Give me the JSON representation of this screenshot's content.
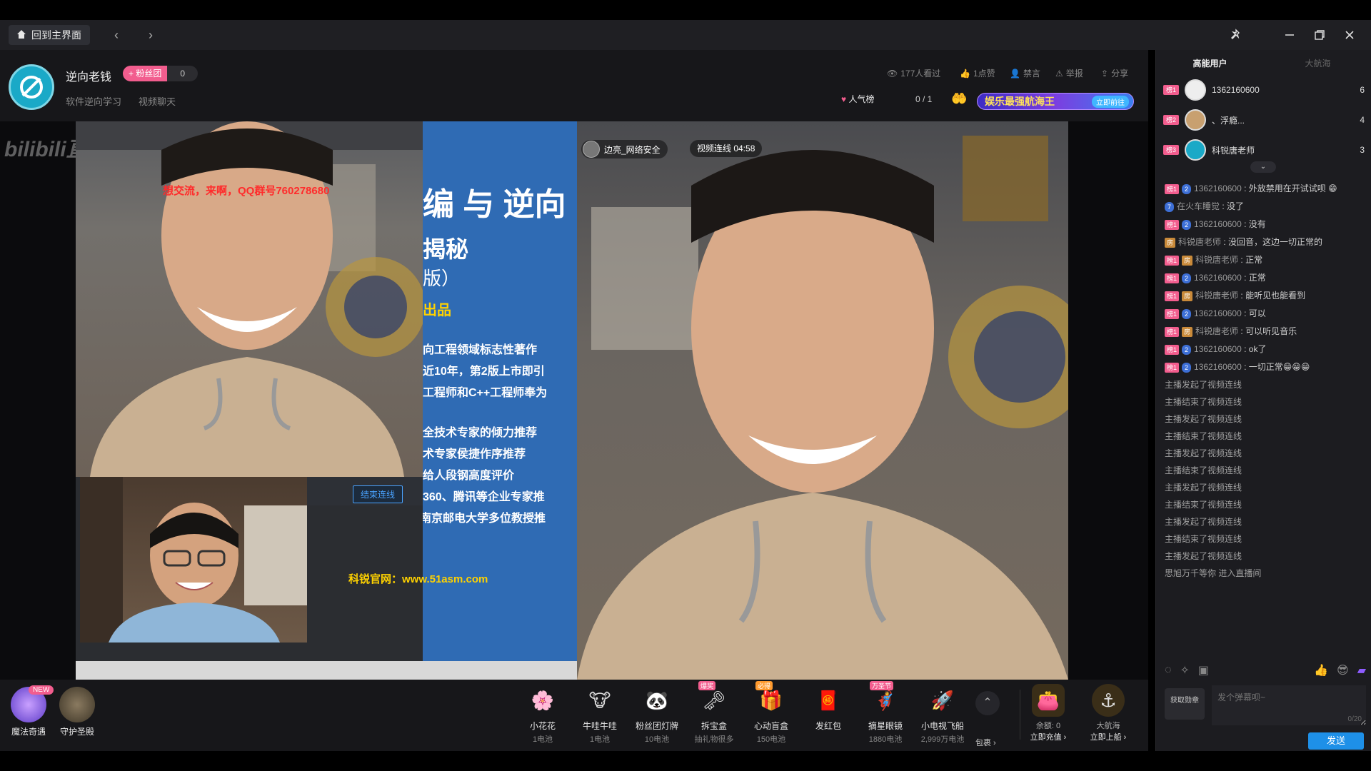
{
  "topbar": {
    "home_label": "回到主界面"
  },
  "header": {
    "host_name": "逆向老钱",
    "fans_label": "+ 粉丝团",
    "fans_count": "0",
    "tags": [
      "软件逆向学习",
      "视频聊天"
    ],
    "stats": {
      "viewers": "177人看过",
      "likes": "1点赞",
      "mute": "禁言",
      "report": "举报",
      "share": "分享"
    },
    "rank_label": "人气榜",
    "rank_value": "0 / 1",
    "banner_text": "娱乐最强航海王",
    "banner_tag": "立即前往"
  },
  "video": {
    "watermark": "bilibili直播",
    "overlay_red": "想交流，来啊，QQ群号760278680",
    "slide": {
      "title": "编 与 逆向",
      "sub": "揭秘",
      "sub2": "版）",
      "produced": "出品",
      "lines": [
        "向工程领域标志性著作",
        "近10年，第2版上市即引",
        "工程师和C++工程师奉为",
        "全技术专家的倾力推荐",
        "术专家侯捷作序推荐",
        "给人段钢高度评价",
        "360、腾讯等企业专家推",
        "武汉大学、南京邮电大学多位教授推"
      ],
      "website": "科锐官网：www.51asm.com"
    },
    "end_link_label": "结束连线",
    "link_user": "边亮_网络安全",
    "link_status": "视频连线  04:58"
  },
  "giftbar": {
    "features": [
      {
        "name": "魔法奇遇",
        "badge": "NEW"
      },
      {
        "name": "守护圣殿",
        "badge": ""
      }
    ],
    "gifts": [
      {
        "name": "小花花",
        "price": "1电池",
        "emoji": "🌸",
        "corner": ""
      },
      {
        "name": "牛哇牛哇",
        "price": "1电池",
        "emoji": "🐮",
        "corner": ""
      },
      {
        "name": "粉丝团灯牌",
        "price": "10电池",
        "emoji": "🐼",
        "corner": ""
      },
      {
        "name": "拆宝盒",
        "price": "抽礼物很多",
        "emoji": "🗝",
        "corner": "爆奖"
      },
      {
        "name": "心动盲盒",
        "price": "150电池",
        "emoji": "🎁",
        "corner": "必得"
      },
      {
        "name": "发红包",
        "price": "",
        "emoji": "🧧",
        "corner": ""
      },
      {
        "name": "摘星眼镜",
        "price": "1880电池",
        "emoji": "🦸",
        "corner": "万圣节"
      },
      {
        "name": "小电视飞船",
        "price": "2,999万电池",
        "emoji": "🚀",
        "corner": ""
      }
    ],
    "more_label": "包裹 ›",
    "balance_label": "余额: 0",
    "recharge_label": "立即充值 ›",
    "captain_label": "大航海",
    "board_label": "立即上船 ›"
  },
  "sidepanel": {
    "tabs": [
      "高能用户",
      "大航海"
    ],
    "ranking": [
      {
        "rank": "榜1",
        "name": "1362160600",
        "score": "6"
      },
      {
        "rank": "榜2",
        "name": "、浮瘾...",
        "score": "4"
      },
      {
        "rank": "榜3",
        "name": "科锐唐老师",
        "score": "3"
      }
    ],
    "chat": [
      {
        "lv": "榜1",
        "vv": "2",
        "user": "1362160600",
        "text": "外放禁用在开试试呗 😁",
        "sys": false
      },
      {
        "lv": "",
        "vv": "7",
        "user": "在火车睡觉",
        "text": "没了",
        "sys": false
      },
      {
        "lv": "榜1",
        "vv": "2",
        "user": "1362160600",
        "text": "没有",
        "sys": false
      },
      {
        "lv": "",
        "room": "房",
        "user": "科锐唐老师",
        "text": "没回音，这边一切正常的",
        "sys": false
      },
      {
        "lv": "榜1",
        "room": "房",
        "user": "科锐唐老师",
        "text": "正常",
        "sys": false
      },
      {
        "lv": "榜1",
        "vv": "2",
        "user": "1362160600",
        "text": "正常",
        "sys": false
      },
      {
        "lv": "榜1",
        "room": "房",
        "user": "科锐唐老师",
        "text": "能听见也能看到",
        "sys": false
      },
      {
        "lv": "榜1",
        "vv": "2",
        "user": "1362160600",
        "text": "可以",
        "sys": false
      },
      {
        "lv": "榜1",
        "room": "房",
        "user": "科锐唐老师",
        "text": "可以听见音乐",
        "sys": false
      },
      {
        "lv": "榜1",
        "vv": "2",
        "user": "1362160600",
        "text": "ok了",
        "sys": false
      },
      {
        "lv": "榜1",
        "vv": "2",
        "user": "1362160600",
        "text": "一切正常😁😁😁",
        "sys": false
      },
      {
        "text": "主播发起了视频连线",
        "sys": true
      },
      {
        "text": "主播结束了视频连线",
        "sys": true
      },
      {
        "text": "主播发起了视频连线",
        "sys": true
      },
      {
        "text": "主播结束了视频连线",
        "sys": true
      },
      {
        "text": "主播发起了视频连线",
        "sys": true
      },
      {
        "text": "主播结束了视频连线",
        "sys": true
      },
      {
        "text": "主播发起了视频连线",
        "sys": true
      },
      {
        "text": "主播结束了视频连线",
        "sys": true
      },
      {
        "text": "主播发起了视频连线",
        "sys": true
      },
      {
        "text": "主播结束了视频连线",
        "sys": true
      },
      {
        "text": "主播发起了视频连线",
        "sys": true
      },
      {
        "text": "思旭万千等你 进入直播间",
        "sys": true
      }
    ],
    "medal_label": "获取勋章",
    "input_placeholder": "发个弹幕呗~",
    "char_count": "0/20",
    "send_label": "发送"
  },
  "colors": {
    "accent_pink": "#f25d8e",
    "accent_blue": "#1e90e8"
  }
}
